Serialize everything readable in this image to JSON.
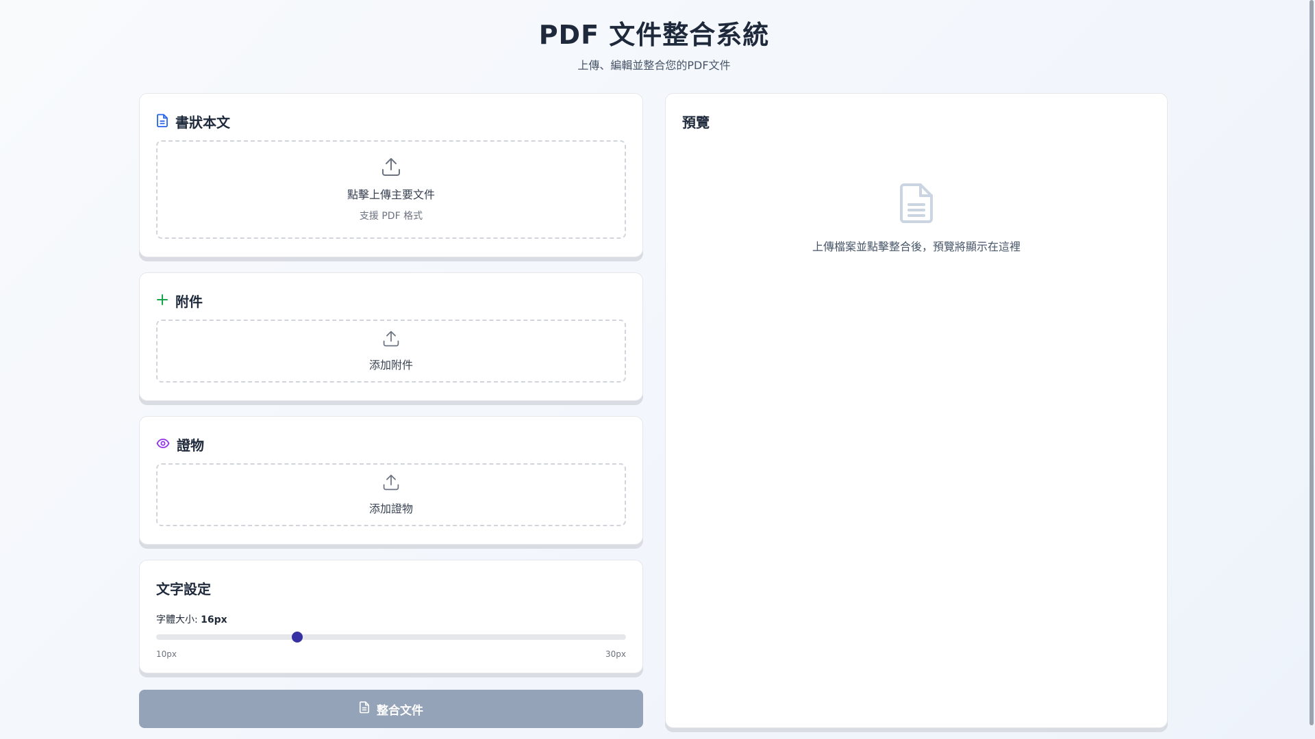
{
  "header": {
    "title": "PDF 文件整合系統",
    "subtitle": "上傳、編輯並整合您的PDF文件"
  },
  "main_letter": {
    "title": "書狀本文",
    "icon": "document-icon",
    "upload_label": "點擊上傳主要文件",
    "upload_hint": "支援 PDF 格式"
  },
  "attachments": {
    "title": "附件",
    "icon": "plus-icon",
    "upload_label": "添加附件"
  },
  "evidence": {
    "title": "證物",
    "icon": "eye-icon",
    "upload_label": "添加證物"
  },
  "text_settings": {
    "title": "文字設定",
    "font_size_label": "字體大小:",
    "font_size_value": "16px",
    "font_size": 16,
    "min": 10,
    "max": 30,
    "min_label": "10px",
    "max_label": "30px"
  },
  "merge_button": {
    "label": "整合文件",
    "icon": "document-icon"
  },
  "preview": {
    "title": "預覽",
    "empty_message": "上傳檔案並點擊整合後，預覽將顯示在這裡",
    "icon": "file-text-icon"
  },
  "colors": {
    "accent_blue": "#2563eb",
    "accent_green": "#16a34a",
    "accent_purple": "#9333ea",
    "slider_thumb": "#3730a3",
    "button_disabled": "#94a3b8"
  }
}
